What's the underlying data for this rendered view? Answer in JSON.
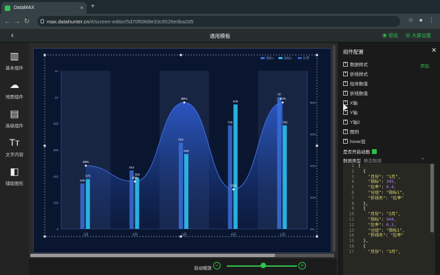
{
  "browser": {
    "tab_title": "DataMAX",
    "url_host": "max.datahunter.cn",
    "url_path": "/#/screen-editor/5d70f6968e33c6526e0ba2d5"
  },
  "app": {
    "title": "通用模板",
    "preview_label": "预览",
    "bigscreen_label": "大屏设置"
  },
  "left_nav": [
    {
      "label": "基本组件",
      "icon": "bar-chart-icon"
    },
    {
      "label": "地图组件",
      "icon": "map-icon"
    },
    {
      "label": "高级组件",
      "icon": "dashboard-icon"
    },
    {
      "label": "文字内容",
      "icon": "text-icon"
    },
    {
      "label": "辅助图形",
      "icon": "shapes-icon"
    }
  ],
  "zoom": {
    "label": "自动缩放",
    "level": 0.5
  },
  "panel": {
    "title": "组件配置",
    "add_label": "添加",
    "sections": [
      "数据样式",
      "折线样式",
      "柱体数值",
      "折线数值",
      "X轴",
      "Y轴",
      "Y轴2",
      "图例",
      "hover层"
    ],
    "animation_label": "是否开启动画",
    "data_type_label": "数据类型",
    "data_type_value": "静态数据",
    "code_lines": [
      {
        "n": "1",
        "t": "["
      },
      {
        "n": "2",
        "t": "  {"
      },
      {
        "n": "3",
        "k": "\"月份\"",
        "v": "\"1月\","
      },
      {
        "n": "4",
        "k": "\"指标\"",
        "v": "345,"
      },
      {
        "n": "5",
        "k": "\"比率\"",
        "v": "0.4,"
      },
      {
        "n": "6",
        "k": "\"分组\"",
        "v": "\"指标1\","
      },
      {
        "n": "7",
        "k": "\"折线名\"",
        "v": "\"比率\""
      },
      {
        "n": "8",
        "t": "  },"
      },
      {
        "n": "9",
        "t": "  {"
      },
      {
        "n": "10",
        "k": "\"月份\"",
        "v": "\"2月\","
      },
      {
        "n": "11",
        "k": "\"指标\"",
        "v": "444,"
      },
      {
        "n": "12",
        "k": "\"比率\"",
        "v": "0.3,"
      },
      {
        "n": "13",
        "k": "\"分组\"",
        "v": "\"指标1\","
      },
      {
        "n": "14",
        "k": "\"折线名\"",
        "v": "\"比率\""
      },
      {
        "n": "15",
        "t": "  },"
      },
      {
        "n": "16",
        "t": "  {"
      },
      {
        "n": "17",
        "k": "\"月份\"",
        "v": "\"3月\","
      }
    ]
  },
  "chart_data": {
    "type": "bar",
    "categories": [
      "1月",
      "2月",
      "3月",
      "4月",
      "5月"
    ],
    "series": [
      {
        "name": "指标1",
        "values": [
          345,
          444,
          654,
          786,
          1000
        ],
        "color": "#3a6fd8"
      },
      {
        "name": "指标2",
        "values": [
          378,
          388,
          568,
          945,
          786
        ],
        "color": "#2ab8e8"
      },
      {
        "name": "比率",
        "type": "line",
        "values": [
          0.4,
          0.3,
          0.8,
          0.25,
          0.8
        ],
        "color": "#2a5fd0"
      }
    ],
    "line_labels": [
      "40%",
      "30%",
      "80%",
      "25%",
      "80%"
    ],
    "bar_labels": {
      "指标1": [
        "345",
        "444",
        "654",
        "786",
        "1K"
      ],
      "指标2": [
        "378",
        "388",
        "568",
        "945",
        "786"
      ]
    },
    "y_ticks": [
      "0",
      "200",
      "400",
      "600",
      "800",
      "1K",
      "1K"
    ],
    "y2_ticks": [
      "0%",
      "20%",
      "40%",
      "60%",
      "80%"
    ],
    "ylim": [
      0,
      1200
    ],
    "y2lim": [
      0,
      1.0
    ],
    "legend_position": "top-right",
    "grid": false
  }
}
